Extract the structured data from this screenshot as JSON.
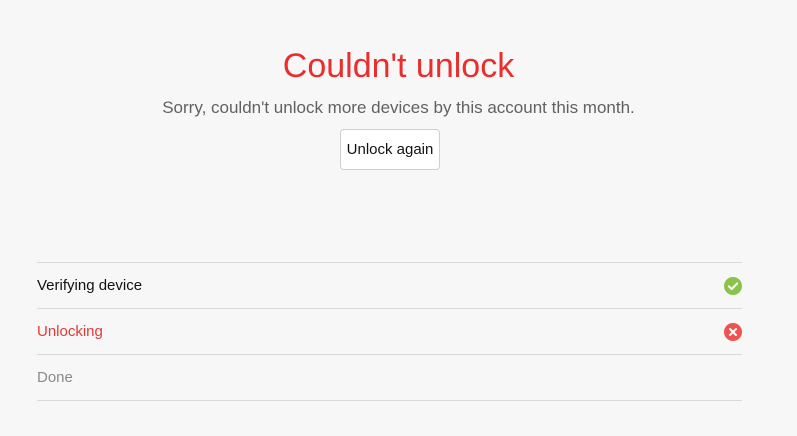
{
  "header": {
    "title": "Couldn't unlock",
    "message": "Sorry, couldn't unlock more devices by this account this month.",
    "retry_button_label": "Unlock again"
  },
  "colors": {
    "error": "#ea2d2d",
    "success": "#8bc34a",
    "failure_icon": "#ef5350",
    "pending_text": "#8a8a8a",
    "background": "#f7f7f7"
  },
  "steps": [
    {
      "label": "Verifying device",
      "status": "success",
      "icon": "check-circle-icon"
    },
    {
      "label": "Unlocking",
      "status": "failed",
      "icon": "error-circle-icon"
    },
    {
      "label": "Done",
      "status": "pending",
      "icon": ""
    }
  ]
}
